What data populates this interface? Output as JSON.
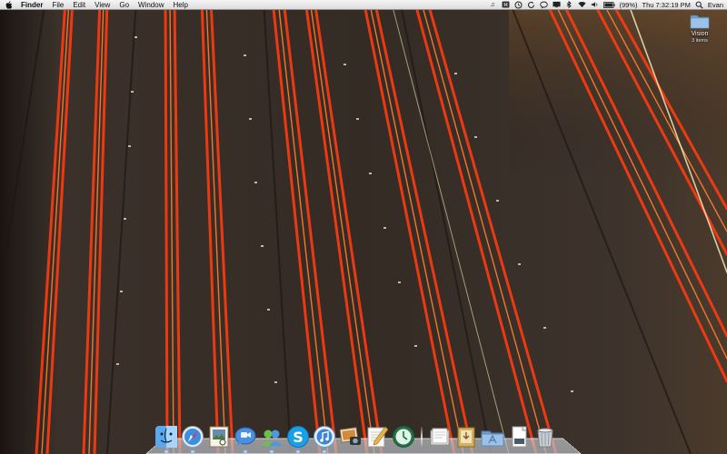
{
  "menubar": {
    "apple_symbol": "",
    "app_name": "Finder",
    "items": [
      "File",
      "Edit",
      "View",
      "Go",
      "Window",
      "Help"
    ],
    "status_icons": [
      "music-note-icon",
      "script-icon",
      "time-machine-icon",
      "sync-icon",
      "chat-icon",
      "display-icon",
      "bluetooth-icon",
      "wifi-icon",
      "volume-icon",
      "battery-icon"
    ],
    "battery_text": "(99%)",
    "clock": "Thu 7:32:19 PM",
    "user": "Evan"
  },
  "desktop": {
    "folder": {
      "name": "Vision",
      "count": "3 items",
      "color": "#8fb7e0"
    }
  },
  "dock": {
    "apps": [
      {
        "name": "finder-icon",
        "running": true
      },
      {
        "name": "safari-icon",
        "running": true
      },
      {
        "name": "preview-icon",
        "running": false
      },
      {
        "name": "ichat-icon",
        "running": true
      },
      {
        "name": "address-book-icon",
        "running": true
      },
      {
        "name": "skype-icon",
        "running": true
      },
      {
        "name": "itunes-icon",
        "running": true
      },
      {
        "name": "iphoto-icon",
        "running": false
      },
      {
        "name": "textedit-icon",
        "running": false
      },
      {
        "name": "time-machine-icon",
        "running": false
      }
    ],
    "stacks": [
      {
        "name": "documents-stack-icon"
      },
      {
        "name": "downloads-stack-icon"
      },
      {
        "name": "applications-stack-icon"
      },
      {
        "name": "document-stack-icon"
      },
      {
        "name": "trash-icon"
      }
    ]
  }
}
